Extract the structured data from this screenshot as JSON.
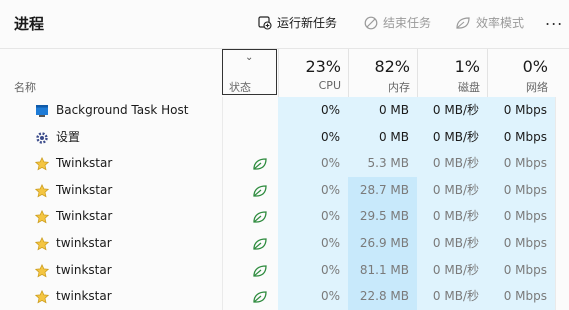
{
  "header": {
    "title": "进程",
    "run_task": "运行新任务",
    "end_task": "结束任务",
    "efficiency": "效率模式",
    "more": "..."
  },
  "columns": {
    "name": "名称",
    "status": "状态",
    "cpu_pct": "23%",
    "cpu": "CPU",
    "mem_pct": "82%",
    "mem": "内存",
    "disk_pct": "1%",
    "disk": "磁盘",
    "net_pct": "0%",
    "net": "网络"
  },
  "rows": [
    {
      "name": "Background Task Host",
      "icon": "app-window-icon",
      "efficiency": false,
      "cpu": "0%",
      "mem": "0 MB",
      "disk": "0 MB/秒",
      "net": "0 Mbps"
    },
    {
      "name": "设置",
      "icon": "gear-icon",
      "efficiency": false,
      "cpu": "0%",
      "mem": "0 MB",
      "disk": "0 MB/秒",
      "net": "0 Mbps"
    },
    {
      "name": "Twinkstar",
      "icon": "star-icon",
      "efficiency": true,
      "cpu": "0%",
      "mem": "5.3 MB",
      "disk": "0 MB/秒",
      "net": "0 Mbps"
    },
    {
      "name": "Twinkstar",
      "icon": "star-icon",
      "efficiency": true,
      "cpu": "0%",
      "mem": "28.7 MB",
      "disk": "0 MB/秒",
      "net": "0 Mbps"
    },
    {
      "name": "Twinkstar",
      "icon": "star-icon",
      "efficiency": true,
      "cpu": "0%",
      "mem": "29.5 MB",
      "disk": "0 MB/秒",
      "net": "0 Mbps"
    },
    {
      "name": "twinkstar",
      "icon": "star-icon",
      "efficiency": true,
      "cpu": "0%",
      "mem": "26.9 MB",
      "disk": "0 MB/秒",
      "net": "0 Mbps"
    },
    {
      "name": "twinkstar",
      "icon": "star-icon",
      "efficiency": true,
      "cpu": "0%",
      "mem": "81.1 MB",
      "disk": "0 MB/秒",
      "net": "0 Mbps"
    },
    {
      "name": "twinkstar",
      "icon": "star-icon",
      "efficiency": true,
      "cpu": "0%",
      "mem": "22.8 MB",
      "disk": "0 MB/秒",
      "net": "0 Mbps"
    }
  ],
  "colors": {
    "heat_light": "#dff3fd",
    "heat_mid": "#c8e9fb"
  }
}
